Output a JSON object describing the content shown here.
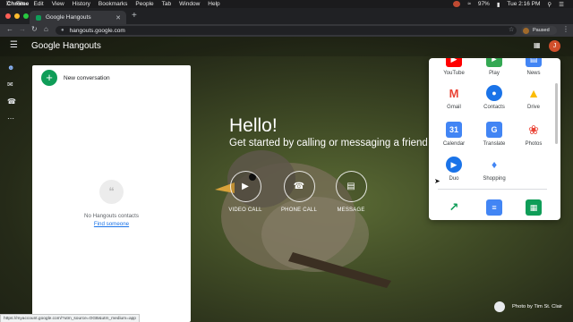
{
  "menubar": {
    "app_name": "Chrome",
    "items": [
      "File",
      "Edit",
      "View",
      "History",
      "Bookmarks",
      "People",
      "Tab",
      "Window",
      "Help"
    ],
    "battery": "97%",
    "clock": "Tue 2:16 PM"
  },
  "browser": {
    "tab_title": "Google Hangouts",
    "url": "hangouts.google.com",
    "profile_status": "Paused"
  },
  "app": {
    "logo_google": "Google",
    "logo_product": "Hangouts",
    "user_initial": "J"
  },
  "conversations": {
    "new_label": "New conversation",
    "empty_text": "No Hangouts contacts",
    "find_link": "Find someone"
  },
  "hero": {
    "greeting": "Hello!",
    "subtitle": "Get started by calling or messaging a friend bel",
    "actions": [
      {
        "label": "VIDEO CALL"
      },
      {
        "label": "PHONE CALL"
      },
      {
        "label": "MESSAGE"
      }
    ]
  },
  "apps_panel": {
    "top_row": [
      "YouTube",
      "Play",
      "News"
    ],
    "rows": [
      [
        "Gmail",
        "Contacts",
        "Drive"
      ],
      [
        "Calendar",
        "Translate",
        "Photos"
      ],
      [
        "Duo",
        "Shopping"
      ]
    ],
    "calendar_day": "31",
    "translate_glyph": "G"
  },
  "credit": "Photo by Tim St. Clair",
  "status_url": "https://myaccount.google.com/?utm_source=OGB&utm_medium=app"
}
